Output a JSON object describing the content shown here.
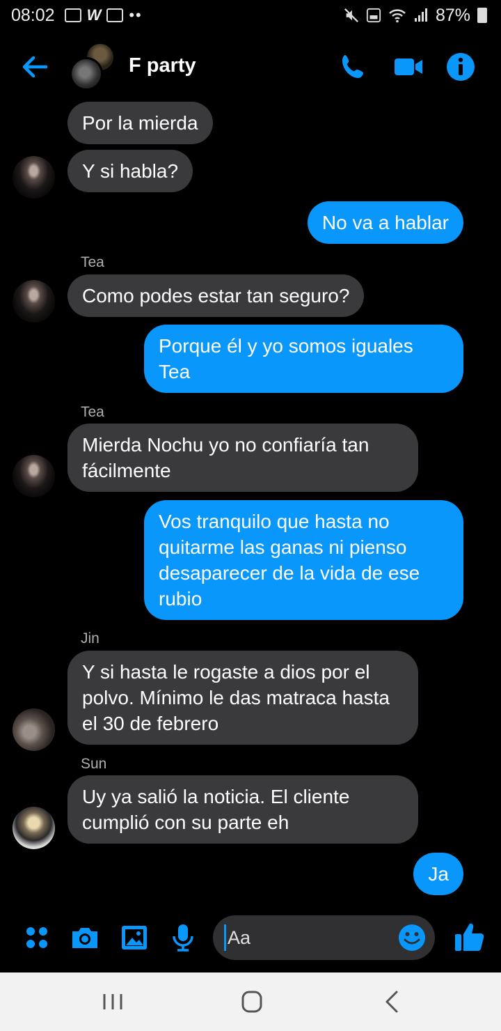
{
  "status_bar": {
    "time": "08:02",
    "battery": "87%"
  },
  "header": {
    "title": "F party"
  },
  "messages": [
    {
      "dir": "in",
      "text": "Por la mierda"
    },
    {
      "dir": "in",
      "text": "Y si habla?"
    },
    {
      "dir": "out",
      "text": "No va a hablar"
    },
    {
      "dir": "in",
      "sender": "Tea",
      "text": "Como podes estar tan seguro?"
    },
    {
      "dir": "out",
      "text": "Porque él y yo somos iguales Tea"
    },
    {
      "dir": "in",
      "sender": "Tea",
      "text": "Mierda Nochu yo no confiaría tan fácilmente"
    },
    {
      "dir": "out",
      "text": "Vos tranquilo que hasta no quitarme las ganas ni pienso desaparecer de la vida de ese rubio"
    },
    {
      "dir": "in",
      "sender": "Jin",
      "text": "Y si hasta le rogaste a dios por el polvo. Mínimo le das matraca hasta el 30 de febrero"
    },
    {
      "dir": "in",
      "sender": "Sun",
      "text": "Uy ya salió la noticia. El cliente cumplió con su parte eh"
    },
    {
      "dir": "out",
      "text": "Ja"
    }
  ],
  "composer": {
    "placeholder": "Aa"
  },
  "colors": {
    "accent": "#0a97fb",
    "incoming_bubble": "#3a3a3c",
    "background": "#000000"
  },
  "icons": [
    "back-arrow-icon",
    "phone-icon",
    "video-camera-icon",
    "info-icon",
    "apps-icon",
    "camera-icon",
    "gallery-icon",
    "microphone-icon",
    "emoji-icon",
    "thumbs-up-icon",
    "recent-apps-icon",
    "home-icon",
    "nav-back-icon"
  ]
}
